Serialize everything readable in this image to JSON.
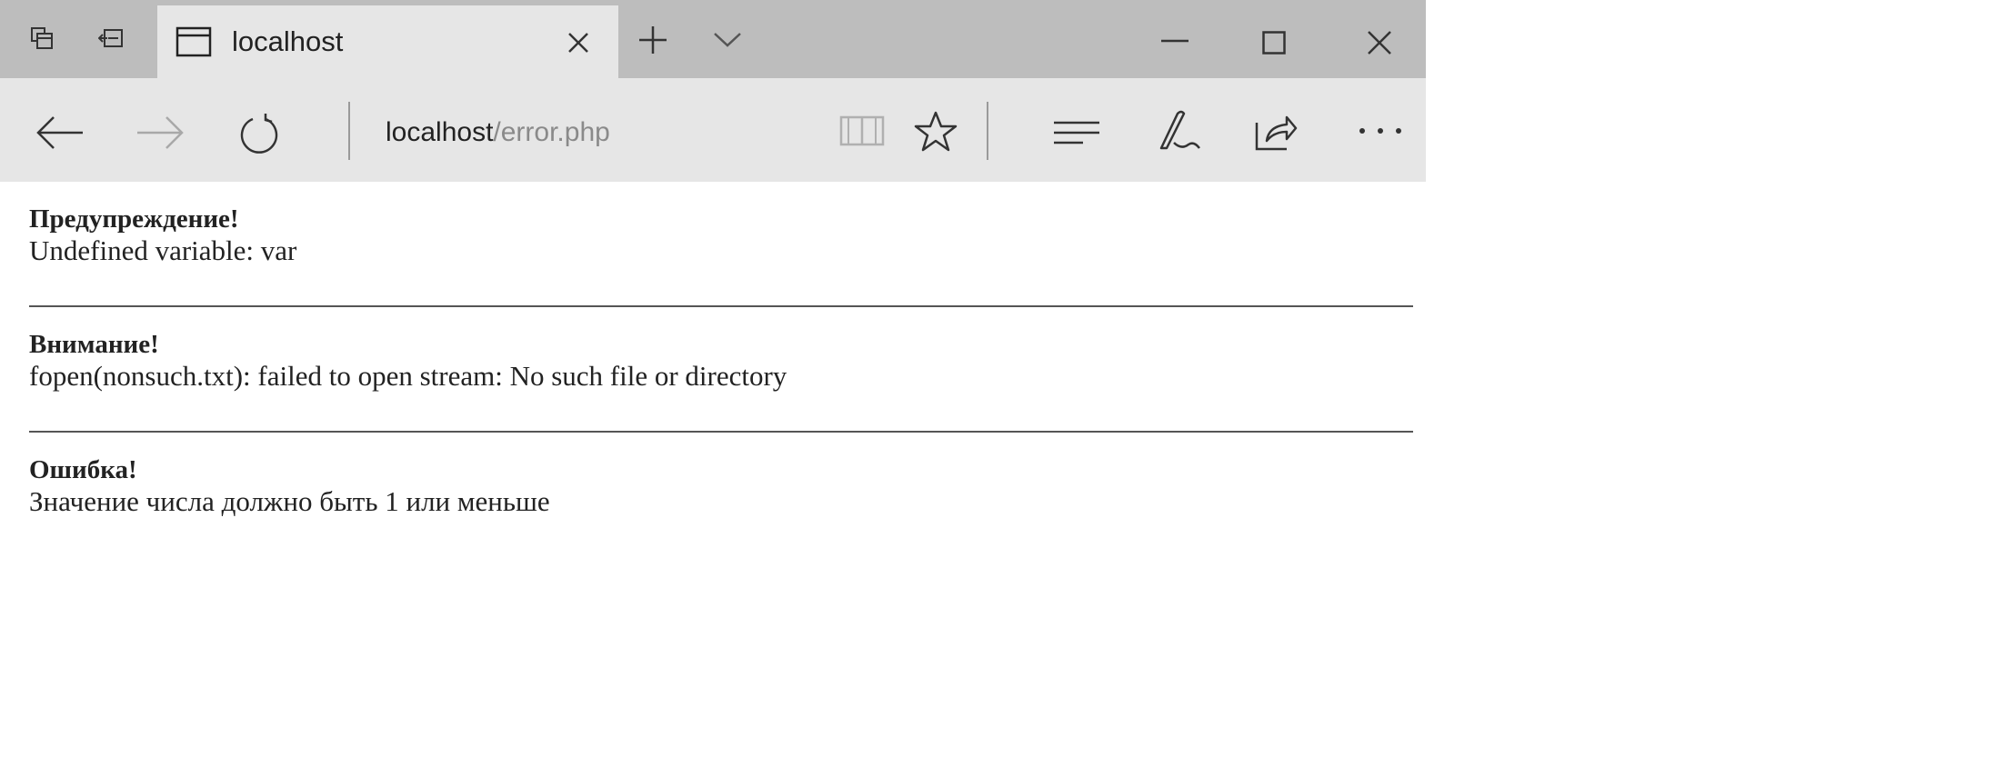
{
  "browser": {
    "tab": {
      "title": "localhost"
    },
    "address": {
      "host": "localhost",
      "path": "/error.php"
    },
    "icons": {
      "tab_actions": "tab-actions-icon",
      "set_aside": "set-aside-tabs-icon",
      "page": "page-icon",
      "close_tab": "close-icon",
      "new_tab": "plus-icon",
      "tab_preview": "chevron-down-icon",
      "minimize": "minimize-icon",
      "maximize": "maximize-icon",
      "close_window": "close-window-icon",
      "back": "back-arrow-icon",
      "forward": "forward-arrow-icon",
      "refresh": "refresh-icon",
      "reading_view": "book-icon",
      "favorite": "star-icon",
      "hub": "hub-icon",
      "web_note": "pen-icon",
      "share": "share-icon",
      "more": "more-icon"
    }
  },
  "messages": [
    {
      "title": "Предупреждение!",
      "text": "Undefined variable: var"
    },
    {
      "title": "Внимание!",
      "text": "fopen(nonsuch.txt): failed to open stream: No such file or directory"
    },
    {
      "title": "Ошибка!",
      "text": "Значение числа должно быть 1 или меньше"
    }
  ]
}
